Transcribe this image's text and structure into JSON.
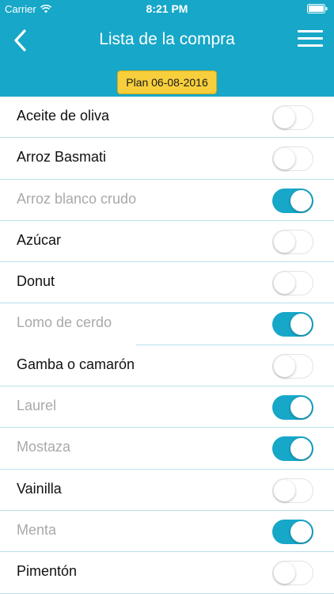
{
  "colors": {
    "accent": "#17a7c8",
    "badge": "#f7cf3c",
    "divider": "#b9e0ec"
  },
  "status_bar": {
    "carrier": "Carrier",
    "time": "8:21 PM"
  },
  "nav": {
    "title": "Lista de la compra",
    "back_icon": "chevron-left-icon",
    "menu_icon": "hamburger-menu-icon"
  },
  "plan_badge": "Plan 06-08-2016",
  "items": [
    {
      "label": "Aceite de oliva",
      "checked": false
    },
    {
      "label": "Arroz Basmati",
      "checked": false
    },
    {
      "label": "Arroz blanco crudo",
      "checked": true
    },
    {
      "label": "Azúcar",
      "checked": false
    },
    {
      "label": "Donut",
      "checked": false
    },
    {
      "label": "Lomo de cerdo",
      "checked": true
    },
    {
      "label": "Gamba o camarón",
      "checked": false
    },
    {
      "label": "Laurel",
      "checked": true
    },
    {
      "label": "Mostaza",
      "checked": true
    },
    {
      "label": "Vainilla",
      "checked": false
    },
    {
      "label": "Menta",
      "checked": true
    },
    {
      "label": "Pimentón",
      "checked": false
    }
  ]
}
